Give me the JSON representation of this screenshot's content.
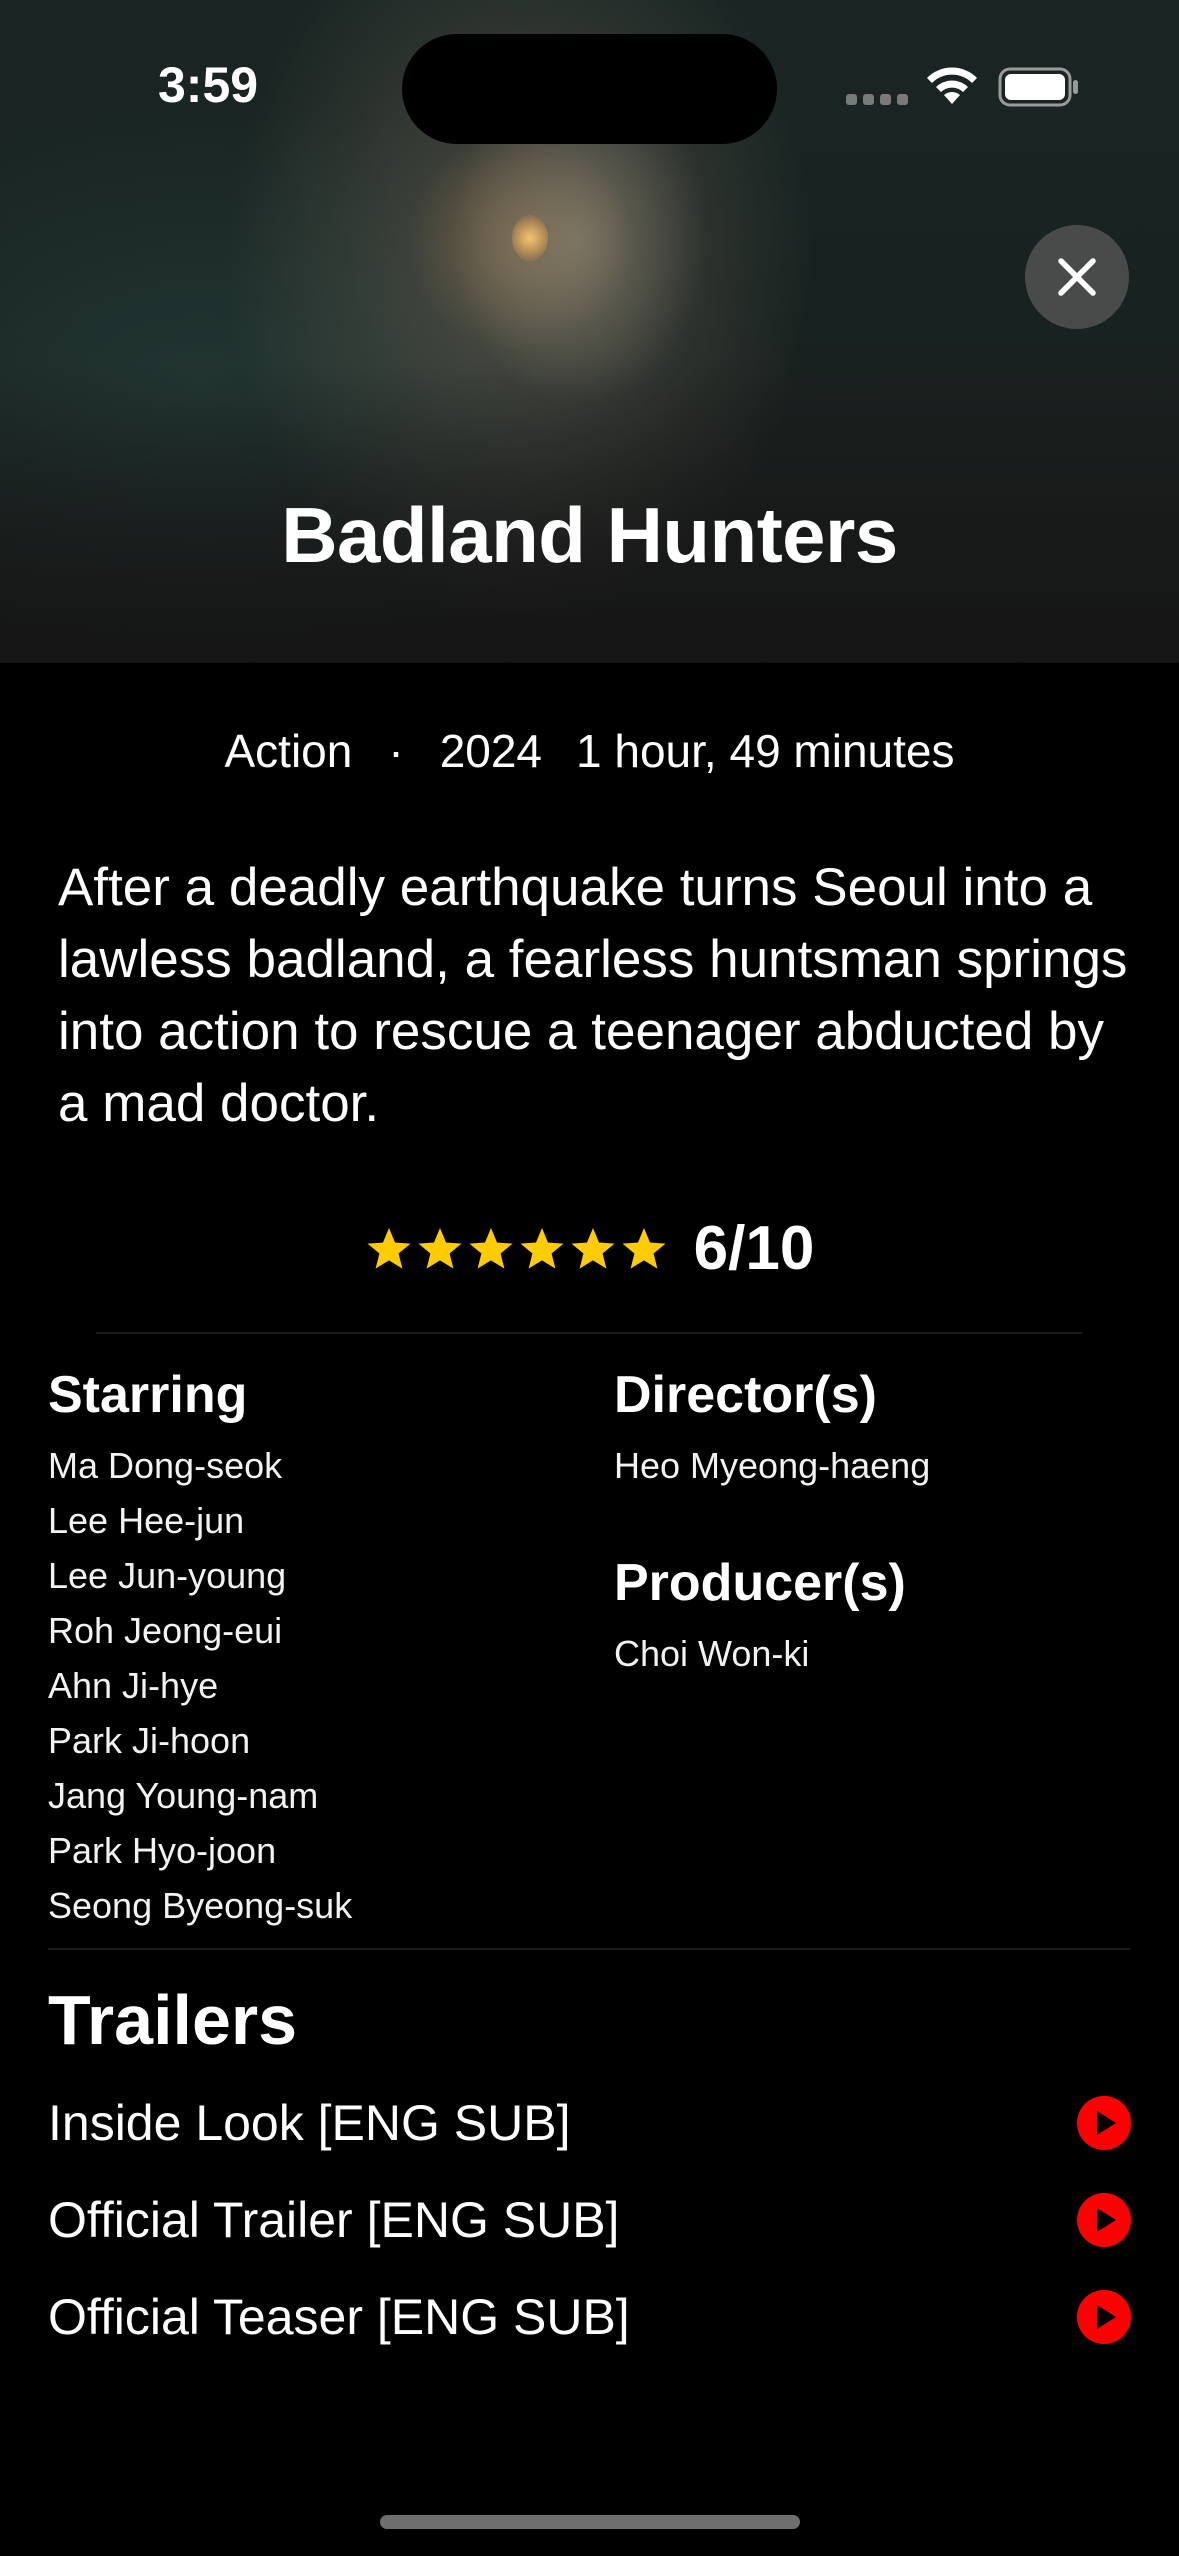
{
  "status_bar": {
    "time": "3:59"
  },
  "movie": {
    "title": "Badland Hunters",
    "genre": "Action",
    "separator": "·",
    "year": "2024",
    "runtime": "1 hour, 49 minutes",
    "synopsis": "After a deadly earthquake turns Seoul into a lawless badland, a fearless huntsman springs into action to rescue a teenager abducted by a mad doctor.",
    "rating": {
      "stars": 6,
      "text": "6/10"
    }
  },
  "credits": {
    "starring_label": "Starring",
    "starring": [
      "Ma Dong-seok",
      "Lee Hee-jun",
      "Lee Jun-young",
      "Roh Jeong-eui",
      "Ahn Ji-hye",
      "Park Ji-hoon",
      "Jang Young-nam",
      "Park Hyo-joon",
      "Seong Byeong-suk"
    ],
    "directors_label": "Director(s)",
    "directors": [
      "Heo Myeong-haeng"
    ],
    "producers_label": "Producer(s)",
    "producers": [
      "Choi Won-ki"
    ]
  },
  "trailers": {
    "title": "Trailers",
    "items": [
      {
        "label": "Inside Look [ENG SUB]"
      },
      {
        "label": "Official Trailer [ENG SUB]"
      },
      {
        "label": "Official Teaser [ENG SUB]"
      }
    ]
  },
  "icons": {
    "close": "close-icon",
    "play": "play-icon",
    "star": "star-icon",
    "wifi": "wifi-icon",
    "battery": "battery-icon"
  },
  "colors": {
    "background": "#000000",
    "star": "#FFCC00",
    "play": "#FF0000",
    "text": "#FFFFFF"
  }
}
